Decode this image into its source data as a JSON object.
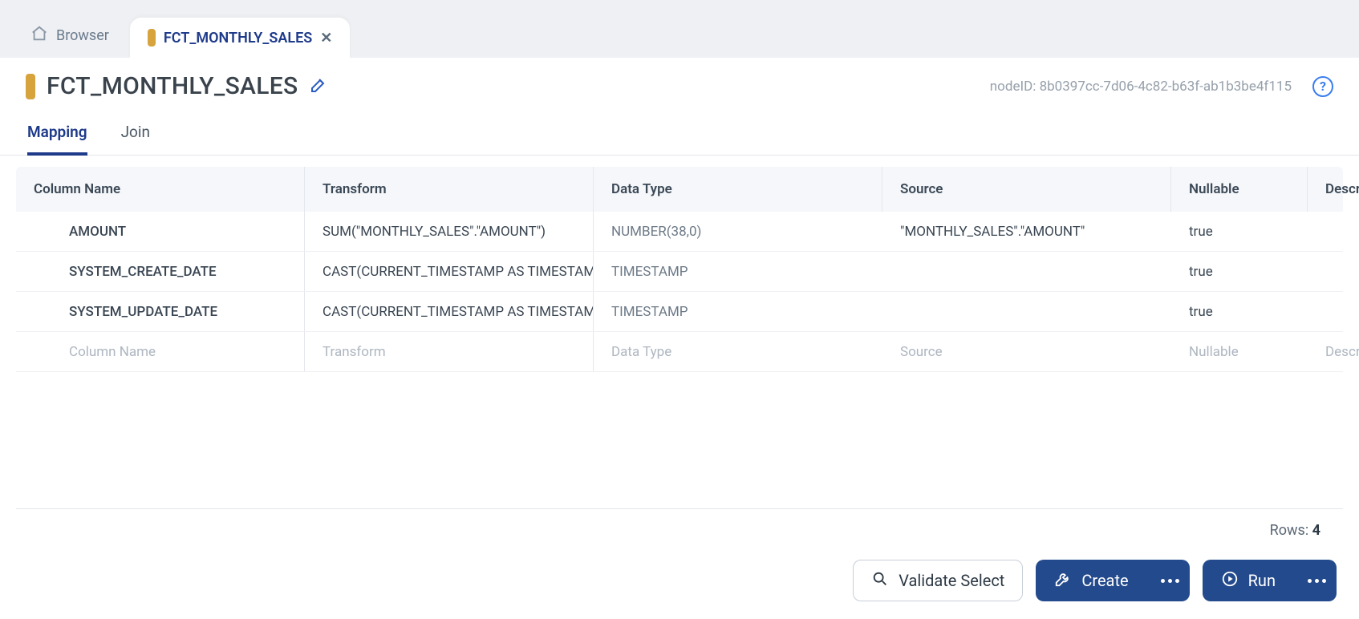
{
  "tabs": {
    "browser_label": "Browser",
    "active_label": "FCT_MONTHLY_SALES"
  },
  "header": {
    "title": "FCT_MONTHLY_SALES",
    "node_id_label": "nodeID: 8b0397cc-7d06-4c82-b63f-ab1b3be4f115"
  },
  "subtabs": {
    "mapping": "Mapping",
    "join": "Join"
  },
  "grid": {
    "headers": {
      "column_name": "Column Name",
      "transform": "Transform",
      "data_type": "Data Type",
      "source": "Source",
      "nullable": "Nullable",
      "description": "Description"
    },
    "rows": [
      {
        "column_name": "AMOUNT",
        "transform": "SUM(\"MONTHLY_SALES\".\"AMOUNT\")",
        "data_type": "NUMBER(38,0)",
        "source": "\"MONTHLY_SALES\".\"AMOUNT\"",
        "nullable": "true"
      },
      {
        "column_name": "SYSTEM_CREATE_DATE",
        "transform": "CAST(CURRENT_TIMESTAMP AS TIMESTAMP)",
        "data_type": "TIMESTAMP",
        "source": "",
        "nullable": "true"
      },
      {
        "column_name": "SYSTEM_UPDATE_DATE",
        "transform": "CAST(CURRENT_TIMESTAMP AS TIMESTAMP)",
        "data_type": "TIMESTAMP",
        "source": "",
        "nullable": "true"
      }
    ],
    "placeholder": {
      "column_name": "Column Name",
      "transform": "Transform",
      "data_type": "Data Type",
      "source": "Source",
      "nullable": "Nullable",
      "description": "Description"
    }
  },
  "footer": {
    "rows_label": "Rows:",
    "rows_count": "4"
  },
  "actions": {
    "validate": "Validate Select",
    "create": "Create",
    "run": "Run"
  }
}
